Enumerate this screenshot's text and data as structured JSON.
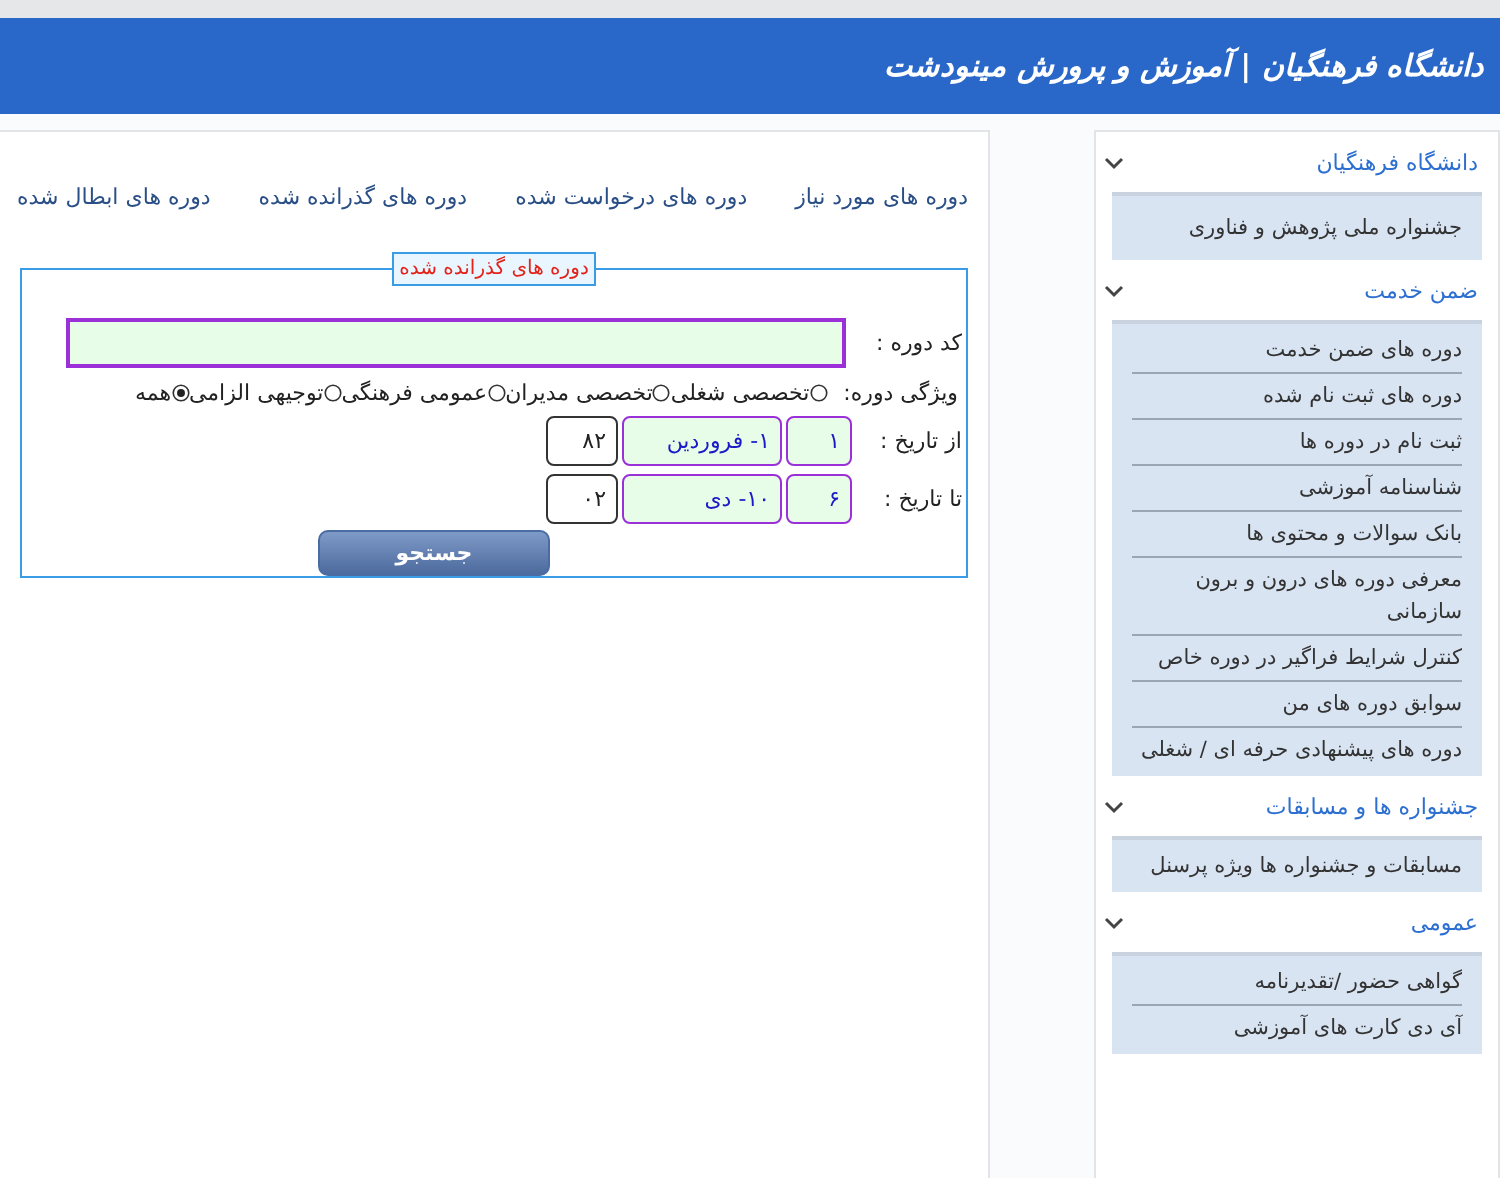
{
  "header": {
    "title": "دانشگاه فرهنگیان | آموزش و پرورش مینودشت"
  },
  "tabs": [
    {
      "label": "دوره های مورد نیاز"
    },
    {
      "label": "دوره های درخواست شده"
    },
    {
      "label": "دوره های گذرانده شده"
    },
    {
      "label": "دوره های ابطال شده"
    }
  ],
  "form": {
    "legend": "دوره های گذرانده شده",
    "code_label": "کد دوره :",
    "feature_label": "ویژگی دوره:",
    "options": [
      {
        "label": "تخصصی شغلی",
        "selected": false
      },
      {
        "label": "تخصصی مدیران",
        "selected": false
      },
      {
        "label": "عمومی فرهنگی",
        "selected": false
      },
      {
        "label": "توجیهی الزامی",
        "selected": false
      },
      {
        "label": "همه",
        "selected": true
      }
    ],
    "dates": [
      {
        "label": "از تاریخ :",
        "day": "۱",
        "month": "۱- فروردین",
        "year": "۸۲"
      },
      {
        "label": "تا تاریخ :",
        "day": "۶",
        "month": "۱۰- دی",
        "year": "۰۲"
      }
    ],
    "search_button": "جستجو"
  },
  "sidebar": {
    "groups": [
      {
        "title": "دانشگاه فرهنگیان",
        "expanded": true,
        "items": [
          "جشنواره ملی پژوهش و فناوری"
        ]
      },
      {
        "title": "ضمن خدمت",
        "expanded": true,
        "items": [
          "دوره های ضمن خدمت",
          "دوره های ثبت نام شده",
          "ثبت نام در دوره ها",
          "شناسنامه آموزشی",
          "بانک سوالات و محتوی ها",
          "معرفی دوره های درون و برون سازمانی",
          "کنترل شرایط فراگیر در دوره خاص",
          "سوابق دوره های من",
          "دوره های پیشنهادی حرفه ای / شغلی"
        ]
      },
      {
        "title": "جشنواره ها و مسابقات",
        "expanded": true,
        "items": [
          "مسابقات و جشنواره ها ویژه پرسنل"
        ]
      },
      {
        "title": "عمومی",
        "expanded": true,
        "items": [
          "گواهی حضور /تقدیرنامه",
          "آی دی کارت های آموزشی"
        ]
      }
    ]
  }
}
